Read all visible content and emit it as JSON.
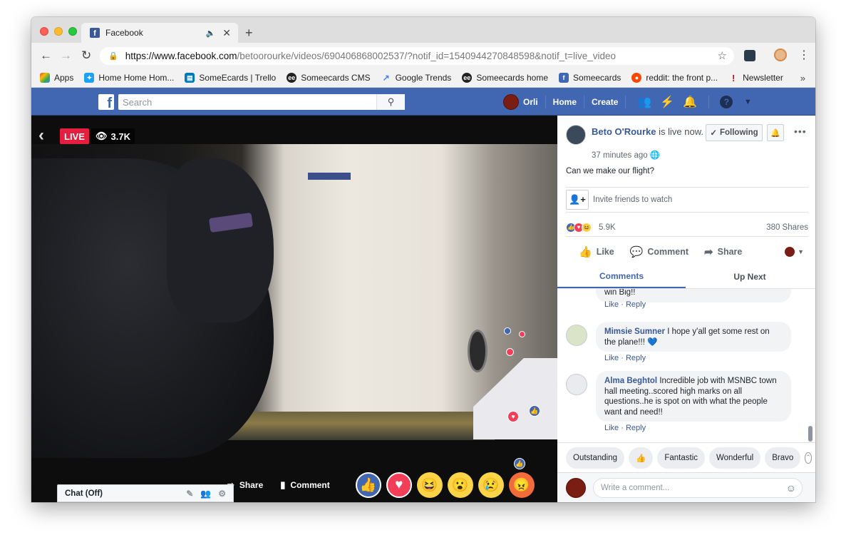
{
  "browser": {
    "tab_title": "Facebook",
    "tab_favicon": "f",
    "url_host": "https://www.facebook.com",
    "url_path": "/betoorourke/videos/690406868002537/?notif_id=1540944270848598&notif_t=live_video"
  },
  "bookmarks": [
    {
      "label": "Apps",
      "icon": "apps-grid-icon",
      "color": "#e8453c"
    },
    {
      "label": "Home Home Hom...",
      "icon": "twitter-bird-icon",
      "color": "#1da1f2"
    },
    {
      "label": "SomeEcards | Trello",
      "icon": "trello-icon",
      "color": "#0079bf"
    },
    {
      "label": "Someecards CMS",
      "icon": "ee-icon",
      "color": "#222222"
    },
    {
      "label": "Google Trends",
      "icon": "trends-icon",
      "color": "#4285f4"
    },
    {
      "label": "Someecards home",
      "icon": "ee-icon",
      "color": "#222222"
    },
    {
      "label": "Someecards",
      "icon": "facebook-icon",
      "color": "#4267b2"
    },
    {
      "label": "reddit: the front p...",
      "icon": "reddit-icon",
      "color": "#ff4500"
    },
    {
      "label": "Newsletter",
      "icon": "exclamation-icon",
      "color": "#d0021b"
    }
  ],
  "fbbar": {
    "search_placeholder": "Search",
    "user_name": "Orli",
    "home_label": "Home",
    "create_label": "Create"
  },
  "video": {
    "live_label": "LIVE",
    "viewer_count": "3.7K",
    "share_label": "Share",
    "comment_label": "Comment"
  },
  "chat": {
    "label": "Chat (Off)"
  },
  "post": {
    "author": "Beto O'Rourke",
    "status_text": "is live now.",
    "time": "37 minutes ago",
    "following_label": "Following",
    "text": "Can we make our flight?",
    "invite_label": "Invite friends to watch",
    "reaction_count": "5.9K",
    "shares_label": "380 Shares",
    "like_label": "Like",
    "comment_label": "Comment",
    "share_label": "Share"
  },
  "panel_tabs": {
    "comments": "Comments",
    "up_next": "Up Next"
  },
  "comments": [
    {
      "name": "",
      "text": "win Big!!",
      "like": "Like",
      "reply": "Reply"
    },
    {
      "name": "Mimsie Sumner",
      "text": "I hope y'all get some rest on the plane!!! 💙",
      "like": "Like",
      "reply": "Reply"
    },
    {
      "name": "Alma Beghtol",
      "text": "Incredible job with MSNBC town hall meeting..scored high marks on all questions..he is spot on with what the people want and need!!",
      "like": "Like",
      "reply": "Reply"
    }
  ],
  "quick_replies": [
    "Outstanding",
    "👍",
    "Fantastic",
    "Wonderful",
    "Bravo"
  ],
  "compose": {
    "placeholder": "Write a comment..."
  },
  "colors": {
    "fb_blue": "#4267b2",
    "live_red": "#e41e3f",
    "link_blue": "#385898"
  }
}
